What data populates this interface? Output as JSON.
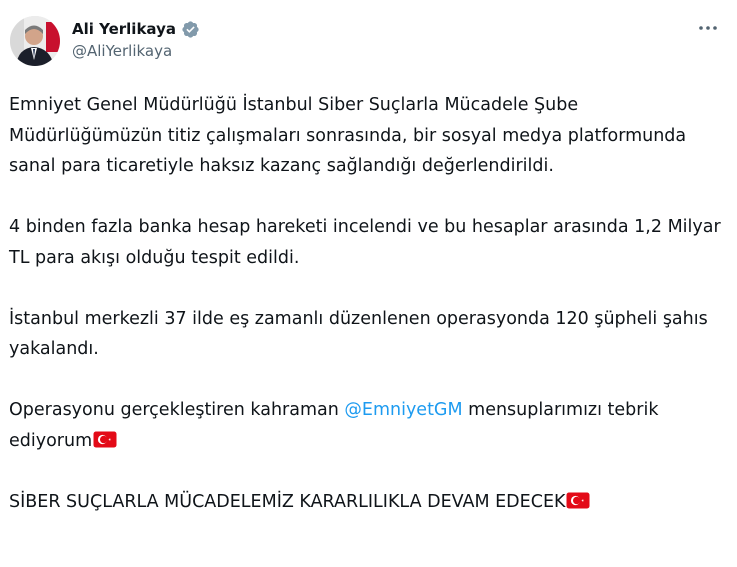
{
  "author": {
    "display_name": "Ali Yerlikaya",
    "handle": "@AliYerlikaya",
    "verified_icon": "verified-badge-icon",
    "badge_color": "#829aab"
  },
  "more_icon": "more-dots-icon",
  "tweet": {
    "p1": "Emniyet Genel Müdürlüğü İstanbul Siber Suçlarla Mücadele Şube Müdürlüğümüzün titiz çalışmaları sonrasında, bir sosyal medya platformunda sanal para ticaretiyle haksız kazanç sağlandığı değerlendirildi.",
    "p2": "4 binden fazla banka hesap hareketi incelendi ve bu hesaplar arasında 1,2 Milyar TL para akışı olduğu tespit edildi.",
    "p3": "İstanbul merkezli 37 ilde eş zamanlı düzenlenen operasyonda 120 şüpheli şahıs yakalandı.",
    "p4_before": "Operasyonu gerçekleştiren kahraman ",
    "p4_mention": "@EmniyetGM",
    "p4_after": " mensuplarımızı tebrik ediyorum",
    "p5": "SİBER SUÇLARLA MÜCADELEMİZ KARARLILIKLA DEVAM EDECEK",
    "flag_icon": "turkey-flag-emoji-icon",
    "mention_color": "#1d9bf0"
  }
}
